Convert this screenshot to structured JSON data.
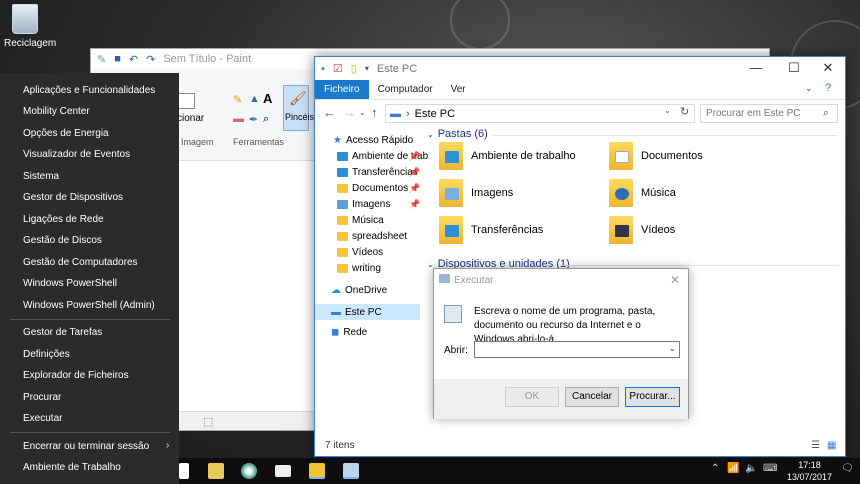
{
  "desktop": {
    "recycle_label": "Reciclagem"
  },
  "paint": {
    "title": "Sem Título - Paint",
    "ribbon_group_image": "Imagem",
    "ribbon_group_tools": "Ferramentas",
    "select_fragment": "cionar",
    "brushes_label": "Pincéis"
  },
  "explorer": {
    "title": "Este PC",
    "tabs": [
      "Ficheiro",
      "Computador",
      "Ver"
    ],
    "address": "Este PC",
    "search_placeholder": "Procurar em Este PC",
    "nav": {
      "quick_access": "Acesso Rápido",
      "items": [
        "Ambiente de trab",
        "Transferências",
        "Documentos",
        "Imagens",
        "Música",
        "spreadsheet",
        "Vídeos",
        "writing"
      ],
      "onedrive": "OneDrive",
      "this_pc": "Este PC",
      "network": "Rede"
    },
    "folders_header": "Pastas (6)",
    "folders": [
      "Ambiente de trabalho",
      "Documentos",
      "Imagens",
      "Música",
      "Transferências",
      "Vídeos"
    ],
    "devices_header": "Dispositivos e unidades (1)",
    "status": "7 itens"
  },
  "run": {
    "title": "Executar",
    "description": "Escreva o nome de um programa, pasta, documento ou recurso da Internet e o Windows abri-lo-á.",
    "open_label": "Abrir:",
    "input_value": "",
    "ok": "OK",
    "cancel": "Cancelar",
    "browse": "Procurar..."
  },
  "winx": {
    "items": [
      "Aplicações e Funcionalidades",
      "Mobility Center",
      "Opções de Energia",
      "Visualizador de Eventos",
      "Sistema",
      "Gestor de Dispositivos",
      "Ligações de Rede",
      "Gestão de Discos",
      "Gestão de Computadores",
      "Windows PowerShell",
      "Windows PowerShell (Admin)",
      "Gestor de Tarefas",
      "Definições",
      "Explorador de Ficheiros",
      "Procurar",
      "Executar",
      "Encerrar ou terminar sessão",
      "Ambiente de Trabalho"
    ]
  },
  "taskbar": {
    "time": "17:18",
    "date": "13/07/2017"
  },
  "colors": {
    "accent": "#1979ca",
    "menu_bg": "#2b2b2b",
    "taskbar_bg": "#0e0e0e"
  }
}
